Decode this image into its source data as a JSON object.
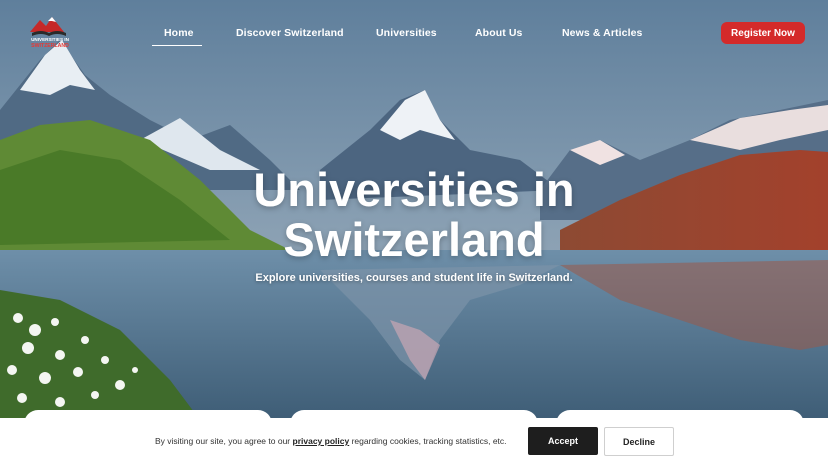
{
  "logo": {
    "line1": "UNIVERSITIES IN",
    "line2": "SWITZERLAND"
  },
  "nav": {
    "items": [
      "Home",
      "Discover Switzerland",
      "Universities",
      "About Us",
      "News & Articles"
    ],
    "register": "Register Now"
  },
  "hero": {
    "title_line1": "Universities in",
    "title_line2": "Switzerland",
    "subtitle": "Explore universities, courses and student life in Switzerland."
  },
  "cookie": {
    "text_before": "By visiting our site, you agree to our ",
    "link": "privacy policy",
    "text_after": " regarding cookies, tracking statistics, etc.",
    "accept": "Accept",
    "decline": "Decline"
  },
  "colors": {
    "accent": "#d42a2a",
    "accept_bg": "#1e1e1e"
  }
}
